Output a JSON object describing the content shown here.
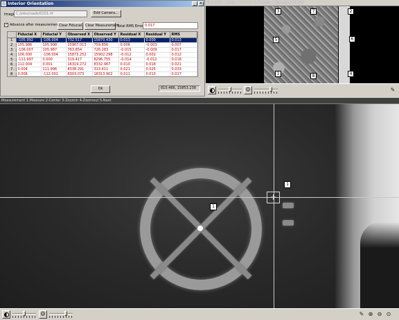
{
  "dialog": {
    "title": "Interior Orientation",
    "image_label": "Image",
    "image_path": "C:/jobs/roads/0201.tif",
    "edit_camera_label": "Edit Camera...",
    "advance_label": "Advance after measurement",
    "advance_checked": "✓",
    "clear_fiducial_label": "Clear Fiducial",
    "clear_measurement_label": "Clear Measurement",
    "rms_label": "Total RMS Error",
    "rms_value": "0.017",
    "ok_label": "Ok",
    "status_coords": "810.466, 15853.238",
    "columns": [
      "",
      "Fiducial X",
      "Fiducial Y",
      "Observed X",
      "Observed Y",
      "Residual X",
      "Residual Y",
      "RMS"
    ],
    "rows": [
      [
        "1",
        "-105.992",
        "-106.004",
        "732.517",
        "15870.430",
        "0.013",
        "0.000",
        "0.013"
      ],
      [
        "2",
        "105.986",
        "105.998",
        "15907.013",
        "759.856",
        "0.006",
        "-0.003",
        "0.007"
      ],
      [
        "3",
        "-106.007",
        "105.987",
        "763.854",
        "726.283",
        "-0.015",
        "-0.009",
        "0.017"
      ],
      [
        "4",
        "106.000",
        "-106.004",
        "15873.252",
        "15902.298",
        "-0.012",
        "0.002",
        "0.012"
      ],
      [
        "5",
        "-111.997",
        "0.000",
        "319.417",
        "8296.755",
        "-0.014",
        "-0.012",
        "0.018"
      ],
      [
        "6",
        "112.004",
        "0.001",
        "16319.272",
        "8332.967",
        "0.010",
        "0.018",
        "0.021"
      ],
      [
        "7",
        "0.004",
        "111.996",
        "8338.291",
        "313.411",
        "0.021",
        "0.025",
        "0.033"
      ],
      [
        "8",
        "0.006",
        "-112.001",
        "8303.073",
        "16313.902",
        "0.011",
        "0.013",
        "0.017"
      ]
    ]
  },
  "overview": {
    "title": "Overview  1-Copy  2-Center  3-Zoomin  4-Zoomout  5-Next",
    "marks": {
      "m1": "1",
      "m2": "2",
      "m3": "3",
      "m4": "4",
      "m5": "5",
      "m6": "6",
      "m7": "7",
      "m8": "8"
    }
  },
  "measurement": {
    "title": "Measurement  1-Measure  2-Center  3-Zoomin  4-Zoomout  5-Next",
    "fiducial_mark": "1",
    "side_mark": "1",
    "crosshair_glyph": "+"
  },
  "icons": {
    "contrast": "contrast-icon",
    "gear": "gear-icon",
    "pencil": "pencil-icon",
    "zoom_in": "zoom-in-icon",
    "zoom_out": "zoom-out-icon",
    "zoom_fit": "zoom-fit-icon"
  }
}
